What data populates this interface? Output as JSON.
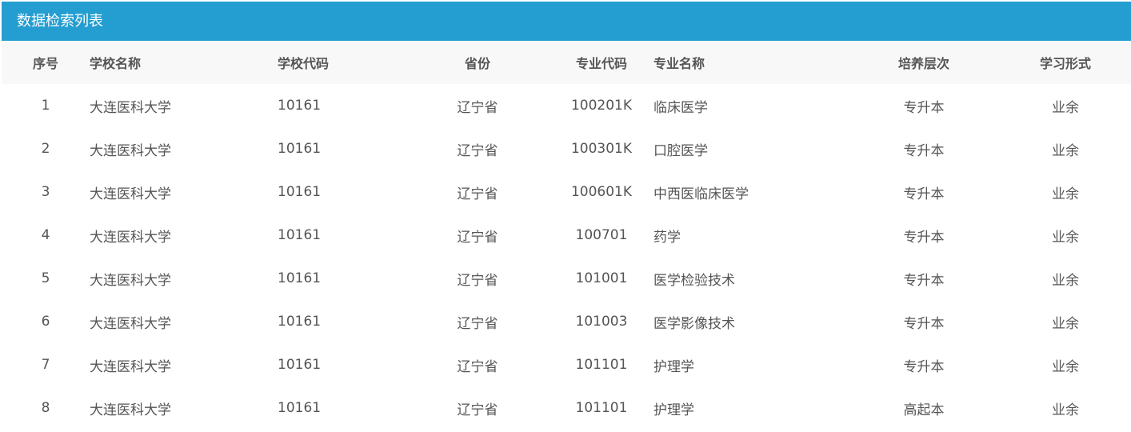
{
  "panel": {
    "title": "数据检索列表"
  },
  "table": {
    "headers": [
      "序号",
      "学校名称",
      "学校代码",
      "省份",
      "专业代码",
      "专业名称",
      "培养层次",
      "学习形式"
    ],
    "rows": [
      [
        "1",
        "大连医科大学",
        "10161",
        "辽宁省",
        "100201K",
        "临床医学",
        "专升本",
        "业余"
      ],
      [
        "2",
        "大连医科大学",
        "10161",
        "辽宁省",
        "100301K",
        "口腔医学",
        "专升本",
        "业余"
      ],
      [
        "3",
        "大连医科大学",
        "10161",
        "辽宁省",
        "100601K",
        "中西医临床医学",
        "专升本",
        "业余"
      ],
      [
        "4",
        "大连医科大学",
        "10161",
        "辽宁省",
        "100701",
        "药学",
        "专升本",
        "业余"
      ],
      [
        "5",
        "大连医科大学",
        "10161",
        "辽宁省",
        "101001",
        "医学检验技术",
        "专升本",
        "业余"
      ],
      [
        "6",
        "大连医科大学",
        "10161",
        "辽宁省",
        "101003",
        "医学影像技术",
        "专升本",
        "业余"
      ],
      [
        "7",
        "大连医科大学",
        "10161",
        "辽宁省",
        "101101",
        "护理学",
        "专升本",
        "业余"
      ],
      [
        "8",
        "大连医科大学",
        "10161",
        "辽宁省",
        "101101",
        "护理学",
        "高起本",
        "业余"
      ]
    ]
  },
  "colors": {
    "header_bar": "#249ed1",
    "table_head_bg": "#f8f8f8",
    "text": "#555555"
  }
}
